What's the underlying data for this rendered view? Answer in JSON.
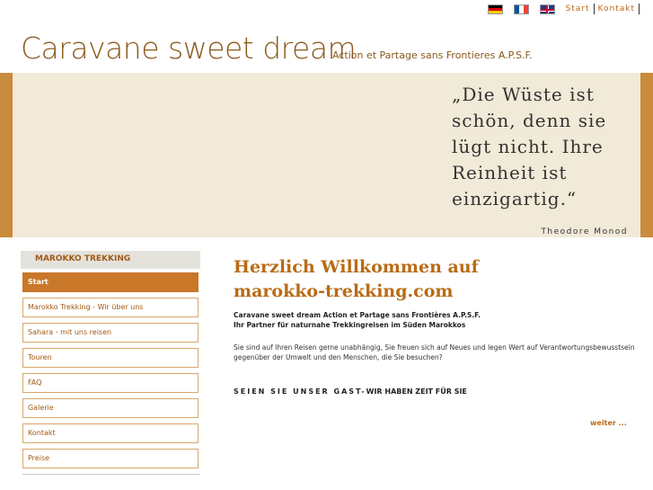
{
  "topnav": {
    "flags": [
      "german-flag-icon",
      "french-flag-icon",
      "uk-flag-icon"
    ],
    "links": [
      "Start",
      "Kontakt"
    ]
  },
  "header": {
    "title": "Caravane sweet dream",
    "subtitle": "Action et Partage sans Frontieres A.P.S.F."
  },
  "banner": {
    "quote_lines": [
      "„Die Wüste ist",
      "schön, denn sie",
      "lügt nicht. Ihre",
      "Reinheit ist",
      "einzigartig.“"
    ],
    "author": "Theodore Monod"
  },
  "sidebar": {
    "heading": "MAROKKO TREKKING",
    "items": [
      {
        "label": "Start",
        "active": true
      },
      {
        "label": "Marokko Trekking - Wir über uns",
        "active": false
      },
      {
        "label": "Sahara - mit uns reisen",
        "active": false
      },
      {
        "label": "Touren",
        "active": false
      },
      {
        "label": "FAQ",
        "active": false
      },
      {
        "label": "Galerie",
        "active": false
      },
      {
        "label": "Kontakt",
        "active": false
      },
      {
        "label": "Preise",
        "active": false
      }
    ]
  },
  "main": {
    "heading": "Herzlich Willkommen auf marokko-trekking.com",
    "intro_line1": "Caravane sweet dream Action et Partage sans Frontières A.P.S.F.",
    "intro_line2": "Ihr Partner für naturnahe Trekkingreisen im Süden Marokkos",
    "paragraph": "Sie sind auf Ihren Reisen gerne unabhängig, Sie freuen sich auf Neues und legen Wert auf Verantwortungsbewusstsein gegenüber der Umwelt und den Menschen, die Sie besuchen?",
    "gast_spaced": "SEIEN SIE UNSER GAST-",
    "gast_rest": "WIR HABEN ZEIT FÜR SIE",
    "more_link": "weiter ..."
  },
  "colors": {
    "accent": "#b86b16",
    "banner_band": "#c98b3c",
    "banner_inner": "#f1ead8",
    "active_menu": "#c9782a"
  }
}
